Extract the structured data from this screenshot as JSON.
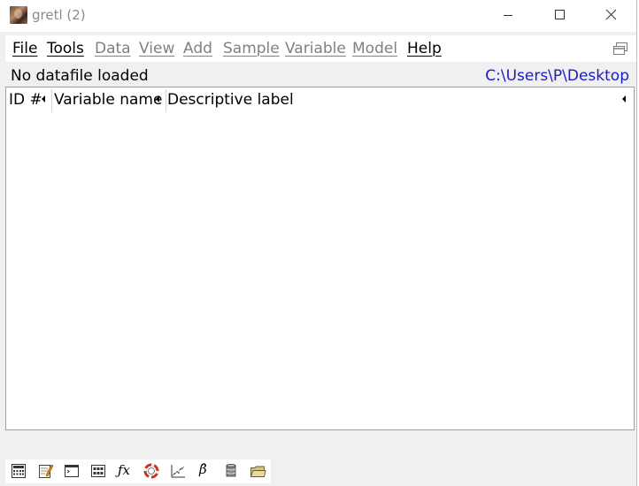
{
  "window": {
    "title": "gretl (2)"
  },
  "menubar": {
    "items": [
      {
        "label": "File",
        "enabled": true
      },
      {
        "label": "Tools",
        "enabled": true
      },
      {
        "label": "Data",
        "enabled": false
      },
      {
        "label": "View",
        "enabled": false
      },
      {
        "label": "Add",
        "enabled": false
      },
      {
        "label": "Sample",
        "enabled": false
      },
      {
        "label": "Variable",
        "enabled": false
      },
      {
        "label": "Model",
        "enabled": false
      },
      {
        "label": "Help",
        "enabled": true
      }
    ]
  },
  "status": {
    "datafile": "No datafile loaded",
    "working_dir": "C:\\Users\\P\\Desktop"
  },
  "listview": {
    "columns": [
      "ID #",
      "Variable name",
      "Descriptive label"
    ],
    "rows": []
  },
  "toolbar": {
    "fx_label": "ƒx",
    "beta_label": "β̂",
    "icons": [
      "calculator-icon",
      "notepad-icon",
      "console-icon",
      "session-icon-view-icon",
      "function-package-icon",
      "help-lifebuoy-icon",
      "graph-icon",
      "model-beta-icon",
      "database-icon",
      "open-folder-icon"
    ]
  },
  "colors": {
    "link": "#1a1acc",
    "disabled_menu": "#808080",
    "title_text": "#8a8a8a"
  }
}
